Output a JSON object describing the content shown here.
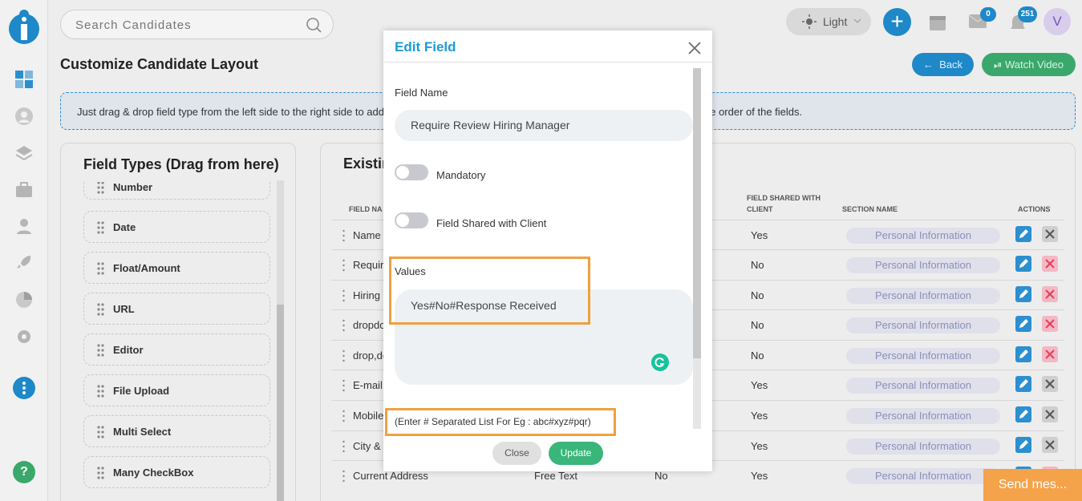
{
  "app": {
    "accent": "#1e88c8",
    "brand_icon": "brand-logo-icon"
  },
  "search": {
    "placeholder": "Search Candidates"
  },
  "topbar": {
    "theme_label": "Light",
    "mail_count": "0",
    "notification_count": "251",
    "avatar_letter": "V"
  },
  "page": {
    "title": "Customize Candidate Layout",
    "back_label": "Back",
    "watch_label": "Watch Video",
    "info_left": "Just drag & drop field type from the left side to the right side to add",
    "info_right": "he order of the fields."
  },
  "field_types": {
    "title": "Field Types (Drag from here)",
    "items": [
      "Number",
      "Date",
      "Float/Amount",
      "URL",
      "Editor",
      "File Upload",
      "Multi Select",
      "Many CheckBox"
    ]
  },
  "existing": {
    "title": "Existin",
    "headers": {
      "field_name": "FIELD NA",
      "shared_1": "FIELD SHARED WITH",
      "shared_2": "CLIENT",
      "section": "SECTION NAME",
      "actions": "ACTIONS"
    },
    "rows": [
      {
        "name": "Name",
        "shared": "Yes",
        "section": "Personal Information",
        "deletable": false
      },
      {
        "name": "Requir",
        "shared": "No",
        "section": "Personal Information",
        "deletable": true
      },
      {
        "name": "Hiring",
        "shared": "No",
        "section": "Personal Information",
        "deletable": true
      },
      {
        "name": "dropdo",
        "shared": "No",
        "section": "Personal Information",
        "deletable": true
      },
      {
        "name": "drop,do",
        "shared": "No",
        "section": "Personal Information",
        "deletable": true
      },
      {
        "name": "E-mail",
        "shared": "Yes",
        "section": "Personal Information",
        "deletable": false
      },
      {
        "name": "Mobile",
        "shared": "Yes",
        "section": "Personal Information",
        "deletable": false
      },
      {
        "name": "City &",
        "shared": "Yes",
        "section": "Personal Information",
        "deletable": false
      },
      {
        "name": "Current Address",
        "type": "Free Text",
        "mandatory": "No",
        "shared": "Yes",
        "section": "Personal Information",
        "deletable": true
      }
    ]
  },
  "modal": {
    "title": "Edit Field",
    "field_name_label": "Field Name",
    "field_name_value": "Require Review Hiring Manager",
    "mandatory_label": "Mandatory",
    "mandatory_on": false,
    "shared_label": "Field Shared with Client",
    "shared_on": false,
    "values_label": "Values",
    "values_value": "Yes#No#Response Received",
    "hint": "(Enter # Separated List For Eg : abc#xyz#pqr)",
    "close_label": "Close",
    "update_label": "Update"
  },
  "chat": {
    "label": "Send mes..."
  },
  "help": {
    "label": "?"
  }
}
